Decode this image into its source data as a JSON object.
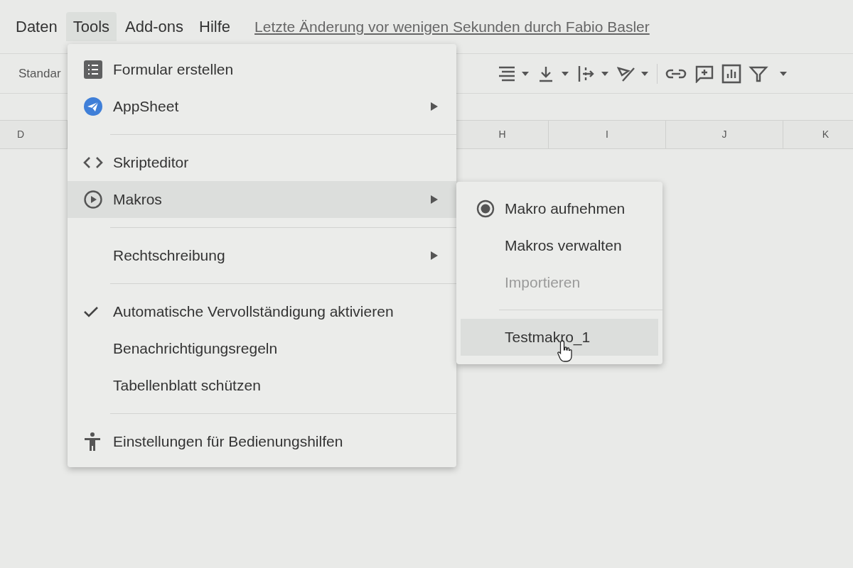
{
  "menubar": {
    "items": [
      {
        "label": "Daten",
        "selected": false
      },
      {
        "label": "Tools",
        "selected": true
      },
      {
        "label": "Add-ons",
        "selected": false
      },
      {
        "label": "Hilfe",
        "selected": false
      }
    ],
    "last_edit": "Letzte Änderung vor wenigen Sekunden durch Fabio Basler"
  },
  "toolbar": {
    "font_label": "Standar"
  },
  "column_headers": [
    "D",
    "H",
    "I",
    "J",
    "K"
  ],
  "tools_menu": [
    {
      "kind": "item",
      "label": "Formular erstellen",
      "submenu": false,
      "selected": false,
      "checked": false
    },
    {
      "kind": "item",
      "label": "AppSheet",
      "submenu": true,
      "selected": false,
      "checked": false
    },
    {
      "kind": "separator"
    },
    {
      "kind": "item",
      "label": "Skripteditor",
      "submenu": false,
      "selected": false,
      "checked": false
    },
    {
      "kind": "item",
      "label": "Makros",
      "submenu": true,
      "selected": true,
      "checked": false
    },
    {
      "kind": "separator"
    },
    {
      "kind": "item",
      "label": "Rechtschreibung",
      "submenu": true,
      "selected": false,
      "checked": false
    },
    {
      "kind": "separator"
    },
    {
      "kind": "item",
      "label": "Automatische Vervollständigung aktivieren",
      "submenu": false,
      "selected": false,
      "checked": true
    },
    {
      "kind": "item",
      "label": "Benachrichtigungsregeln",
      "submenu": false,
      "selected": false,
      "checked": false
    },
    {
      "kind": "item",
      "label": "Tabellenblatt schützen",
      "submenu": false,
      "selected": false,
      "checked": false
    },
    {
      "kind": "separator"
    },
    {
      "kind": "item",
      "label": "Einstellungen für Bedienungshilfen",
      "submenu": false,
      "selected": false,
      "checked": false
    }
  ],
  "macros_submenu": [
    {
      "kind": "item",
      "label": "Makro aufnehmen",
      "disabled": false,
      "selected": false
    },
    {
      "kind": "item",
      "label": "Makros verwalten",
      "disabled": false,
      "selected": false
    },
    {
      "kind": "item",
      "label": "Importieren",
      "disabled": true,
      "selected": false
    },
    {
      "kind": "separator"
    },
    {
      "kind": "item",
      "label": "Testmakro_1",
      "disabled": false,
      "selected": true
    }
  ]
}
